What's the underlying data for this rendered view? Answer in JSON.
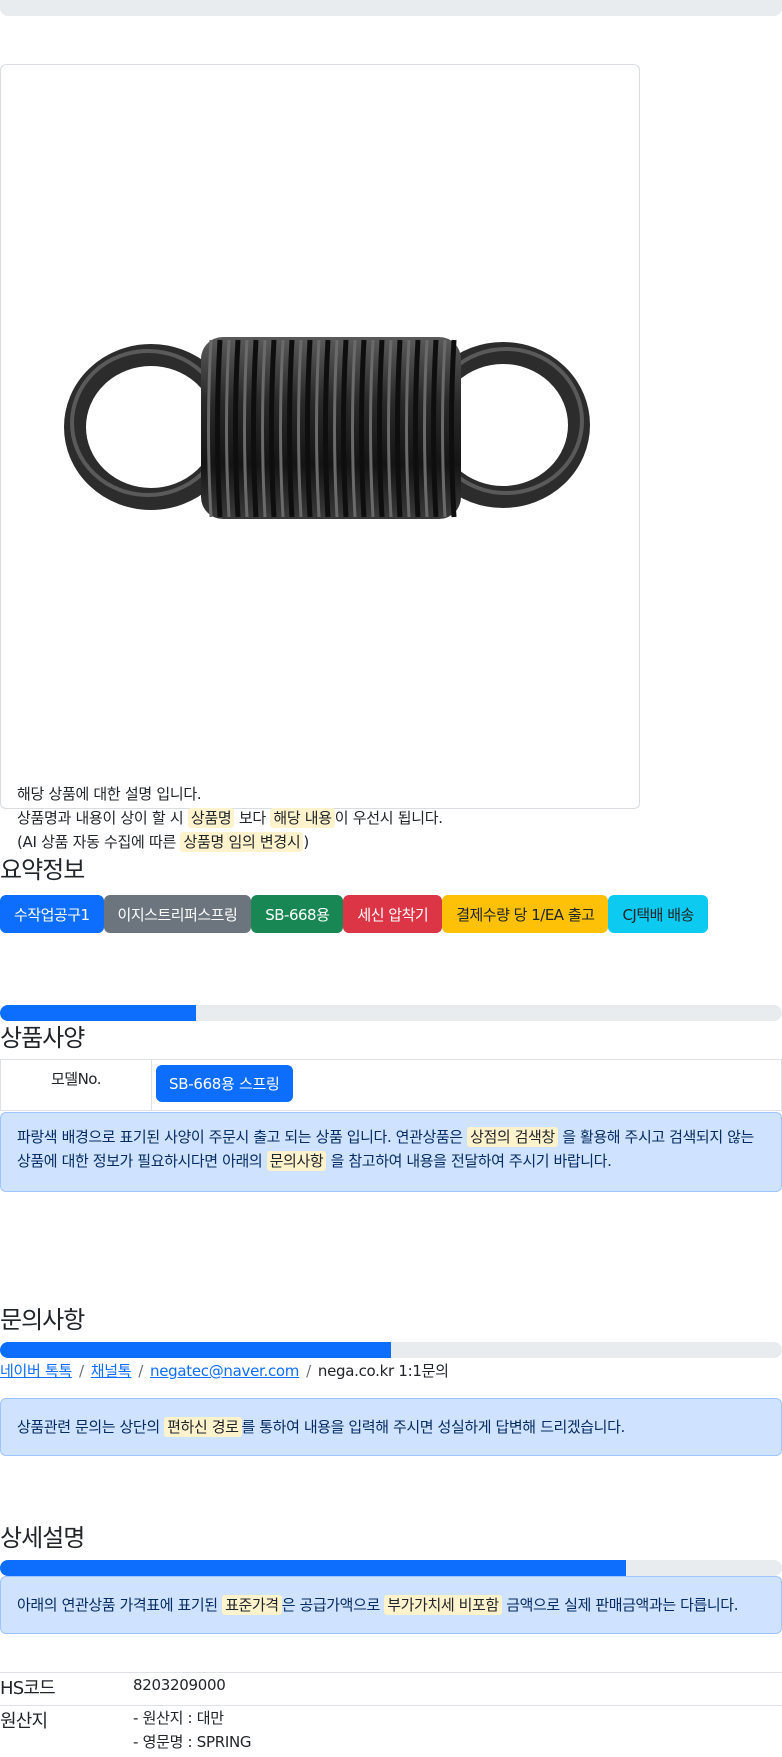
{
  "top_progress": {
    "value": 0
  },
  "product": {
    "description_lines": {
      "line1": "해당 상품에 대한 설명 입니다.",
      "line2_a": "상품명과 내용이 상이 할 시",
      "line2_hl1": "상품명",
      "line2_b": "보다",
      "line2_hl2": "해당 내용",
      "line2_c": "이 우선시 됩니다.",
      "line3_a": "(AI 상품 자동 수집에 따른",
      "line3_hl": "상품명 임의 변경시",
      "line3_b": ")"
    }
  },
  "summary": {
    "title": "요약정보",
    "badges": [
      "수작업공구1",
      "이지스트리퍼스프링",
      "SB-668용",
      "세신 압착기",
      "결제수량 당 1/EA 출고",
      "CJ택배 배송"
    ]
  },
  "specs": {
    "progress": {
      "value": 0.25
    },
    "title": "상품사양",
    "model_label": "모델No.",
    "model_value": "SB-668용 스프링",
    "notice": {
      "a": "파랑색 배경으로 표기된 사양이 주문시 출고 되는 상품 입니다. 연관상품은",
      "hl1": "상점의 검색창",
      "b": "을 활용해 주시고 검색되지 않는 상품에 대한 정보가 필요하시다면 아래의",
      "hl2": "문의사항",
      "c": "을 참고하여 내용을 전달하여 주시기 바랍니다."
    }
  },
  "inquiry": {
    "title": "문의사항",
    "progress": {
      "value": 0.5
    },
    "links": [
      "네이버 톡톡",
      "채널톡",
      "negatec@naver.com"
    ],
    "plain_link": "nega.co.kr 1:1문의",
    "separator": "/",
    "notice": {
      "a": "상품관련 문의는 상단의",
      "hl": "편하신 경로",
      "b": "를 통하여 내용을 입력해 주시면 성실하게 답변해 드리겠습니다."
    }
  },
  "detail": {
    "title": "상세설명",
    "progress": {
      "value": 0.8
    },
    "notice": {
      "a": "아래의 연관상품 가격표에 표기된",
      "hl1": "표준가격",
      "b": "은 공급가액으로",
      "hl2": "부가가치세 비포함",
      "c": "금액으로 실제 판매금액과는 다릅니다."
    }
  },
  "info": {
    "hs_label": "HS코드",
    "hs_value": "8203209000",
    "origin_label": "원산지",
    "origin_lines": [
      "- 원산지 : 대만",
      "- 영문명 : SPRING"
    ]
  },
  "colors": {
    "primary": "#0d6efd",
    "gray": "#6c757d",
    "green": "#198754",
    "red": "#dc3545",
    "yellow": "#ffc107",
    "cyan": "#0dcaf0",
    "alert_bg": "#cfe2ff",
    "highlight": "#fff3cd"
  }
}
